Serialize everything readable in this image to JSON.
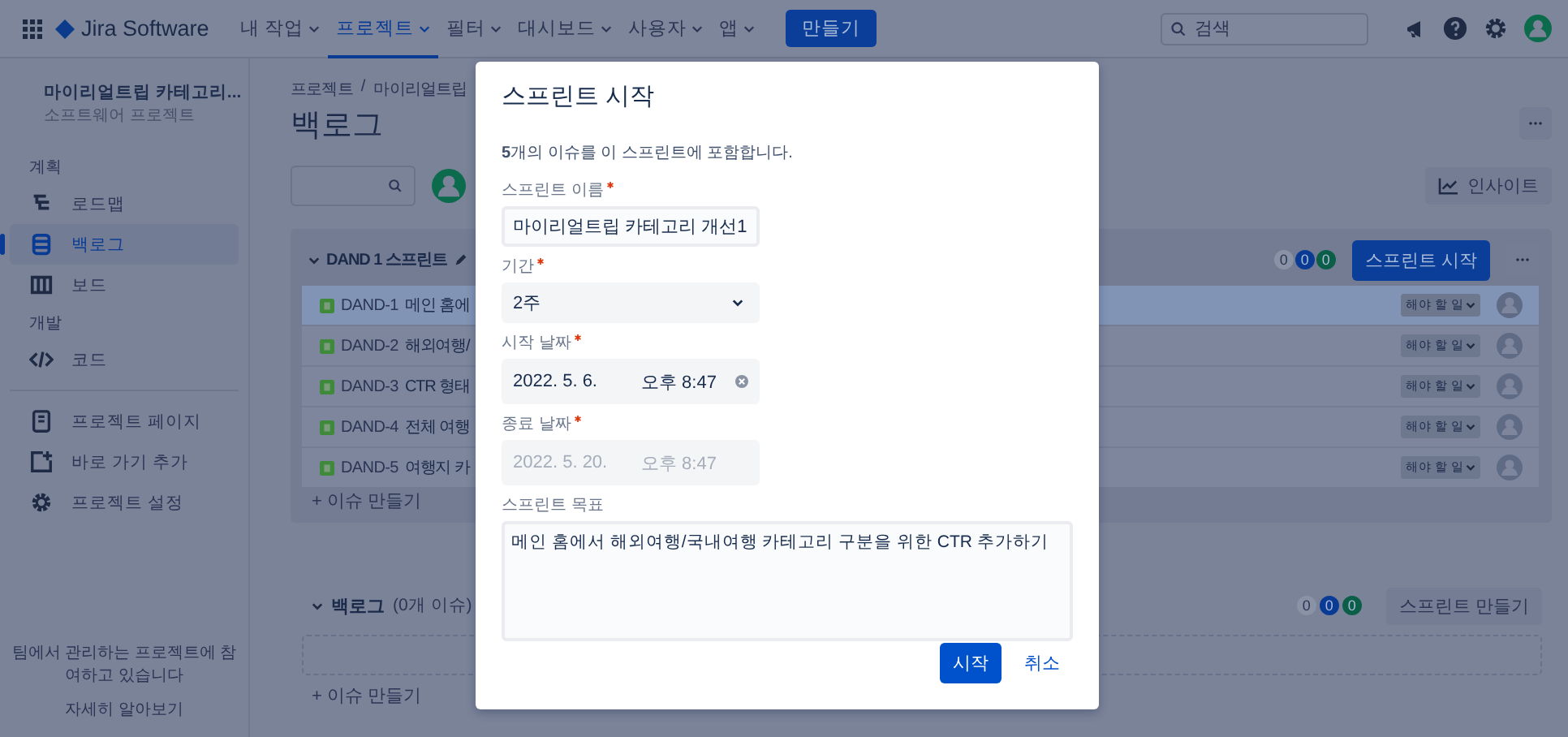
{
  "nav": {
    "logo": "Jira Software",
    "menus": [
      {
        "label": "내 작업",
        "selected": false
      },
      {
        "label": "프로젝트",
        "selected": true
      },
      {
        "label": "필터",
        "selected": false
      },
      {
        "label": "대시보드",
        "selected": false
      },
      {
        "label": "사용자",
        "selected": false
      },
      {
        "label": "앱",
        "selected": false
      }
    ],
    "create_button": "만들기",
    "search": {
      "placeholder": "검색"
    }
  },
  "sidebar": {
    "project_name": "마이리얼트립 카테고리...",
    "project_type": "소프트웨어 프로젝트",
    "sections": [
      {
        "heading": "계획",
        "items": [
          {
            "label": "로드맵",
            "kind": "roadmap",
            "selected": false
          },
          {
            "label": "백로그",
            "kind": "backlog",
            "selected": true
          },
          {
            "label": "보드",
            "kind": "board",
            "selected": false
          }
        ]
      },
      {
        "heading": "개발",
        "items": [
          {
            "label": "코드",
            "kind": "code",
            "selected": false
          }
        ]
      }
    ],
    "extra_items": [
      {
        "label": "프로젝트 페이지",
        "kind": "page"
      },
      {
        "label": "바로 가기 추가",
        "kind": "shortcut"
      },
      {
        "label": "프로젝트 설정",
        "kind": "settings"
      }
    ],
    "footer_text": "팀에서 관리하는 프로젝트에 참여하고 있습니다",
    "footer_link": "자세히 알아보기"
  },
  "main": {
    "breadcrumb": [
      "프로젝트",
      "마이리얼트립"
    ],
    "breadcrumb_separator": "/",
    "title": "백로그",
    "insights_button": "인사이트",
    "sprint": {
      "name": "DAND 1 스프린트",
      "counts": [
        {
          "value": "0",
          "color": "#8a92a6"
        },
        {
          "value": "0",
          "color": "#0a3b94"
        },
        {
          "value": "0",
          "color": "#0b5e47"
        }
      ],
      "start_button": "스프린트 시작",
      "issues": [
        {
          "key": "DAND-1",
          "summary": "메인 홈에",
          "status": "해야 할 일",
          "selected": true
        },
        {
          "key": "DAND-2",
          "summary": "해외여행/",
          "status": "해야 할 일",
          "selected": false
        },
        {
          "key": "DAND-3",
          "summary": "CTR 형태",
          "status": "해야 할 일",
          "selected": false
        },
        {
          "key": "DAND-4",
          "summary": "전체 여행",
          "status": "해야 할 일",
          "selected": false
        },
        {
          "key": "DAND-5",
          "summary": "여행지 카",
          "status": "해야 할 일",
          "selected": false
        }
      ],
      "create_issue": "+ 이슈 만들기"
    },
    "backlog": {
      "title": "백로그",
      "count": "(0개 이슈)",
      "counts": [
        {
          "value": "0",
          "color": "#8a92a6"
        },
        {
          "value": "0",
          "color": "#0a3b94"
        },
        {
          "value": "0",
          "color": "#0b5e47"
        }
      ],
      "create_sprint_button": "스프린트 만들기",
      "create_issue": "+ 이슈 만들기"
    }
  },
  "modal": {
    "title": "스프린트 시작",
    "summary": "**5**개의 이슈를 이 스프린트에 포함합니다.",
    "fields": [
      {
        "kind": "text",
        "label": "스프린트 이름",
        "required": true,
        "value": "마이리얼트립 카테고리 개선1"
      },
      {
        "kind": "select",
        "label": "기간",
        "required": true,
        "value": "2주"
      },
      {
        "kind": "datetime",
        "label": "시작 날짜",
        "required": true,
        "date": "2022. 5. 6.",
        "time": "오후 8:47",
        "disabled": false
      },
      {
        "kind": "datetime",
        "label": "종료 날짜",
        "required": true,
        "date": "2022. 5. 20.",
        "time": "오후 8:47",
        "disabled": true
      },
      {
        "kind": "textarea",
        "label": "스프린트 목표",
        "required": false,
        "value": "메인 홈에서 해외여행/국내여행 카테고리 구분을 위한 CTR 추가하기"
      }
    ],
    "buttons": [
      {
        "label": "시작",
        "kind": "primary"
      },
      {
        "label": "취소",
        "kind": "link"
      }
    ]
  }
}
